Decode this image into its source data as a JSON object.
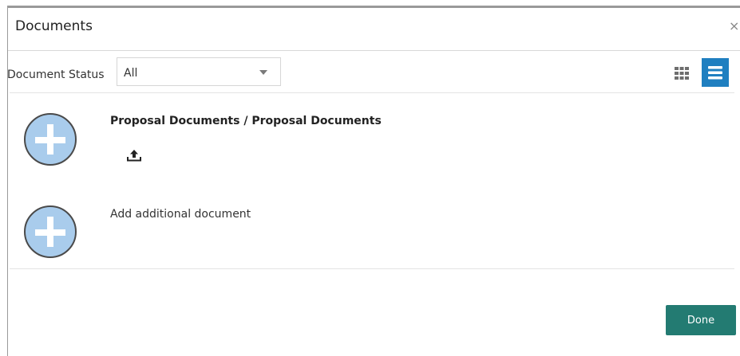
{
  "dialog": {
    "title": "Documents",
    "close_label": "×"
  },
  "filter": {
    "label": "Document Status",
    "selected": "All"
  },
  "view_toggle": {
    "grid_icon": "grid-view-icon",
    "list_icon": "list-view-icon",
    "active": "list",
    "active_color": "#1f7fc0"
  },
  "documents": [
    {
      "title": "Proposal Documents / Proposal Documents",
      "action_icon": "add-circle-icon",
      "upload_icon": "upload-icon"
    },
    {
      "title": "Add additional document",
      "action_icon": "add-circle-icon"
    }
  ],
  "footer": {
    "done_label": "Done",
    "done_color": "#237b72"
  }
}
